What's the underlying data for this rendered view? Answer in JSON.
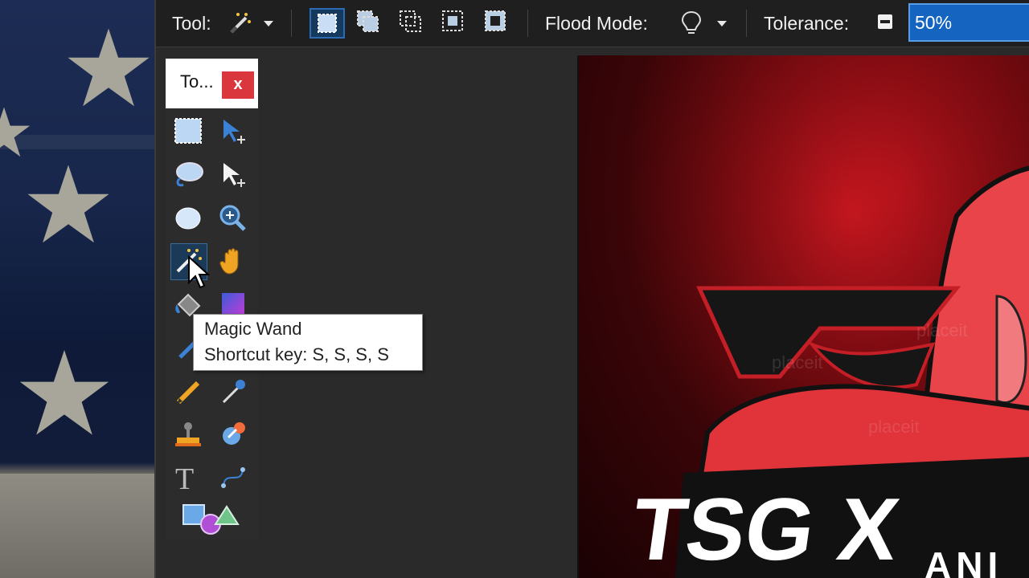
{
  "toolbar": {
    "tool_label": "Tool:",
    "flood_mode_label": "Flood Mode:",
    "tolerance_label": "Tolerance:",
    "tolerance_value": "50%",
    "selection_modes": [
      {
        "icon": "replace-selection-icon",
        "selected": true
      },
      {
        "icon": "union-selection-icon",
        "selected": false
      },
      {
        "icon": "exclude-selection-icon",
        "selected": false
      },
      {
        "icon": "intersect-selection-icon",
        "selected": false
      },
      {
        "icon": "invert-selection-icon",
        "selected": false
      }
    ]
  },
  "tools_window": {
    "title": "To...",
    "close": "x",
    "tools": [
      "rectangle-select-icon",
      "move-selected-icon",
      "lasso-select-icon",
      "move-selection-icon",
      "ellipse-select-icon",
      "zoom-icon",
      "magic-wand-icon",
      "pan-icon",
      "paint-bucket-icon",
      "gradient-icon",
      "paintbrush-icon",
      "eraser-icon",
      "pencil-icon",
      "color-picker-icon",
      "clone-stamp-icon",
      "recolor-icon",
      "text-icon",
      "line-curve-icon",
      "shapes-icon"
    ],
    "active_tool": "magic-wand-icon"
  },
  "tooltip": {
    "title": "Magic Wand",
    "shortcut": "Shortcut key: S, S, S, S"
  },
  "canvas": {
    "logo_text": "TSG X",
    "logo_subtext": "ANI",
    "watermark": "placeit"
  },
  "colors": {
    "accent": "#1565c0",
    "close_red": "#d9363e"
  }
}
